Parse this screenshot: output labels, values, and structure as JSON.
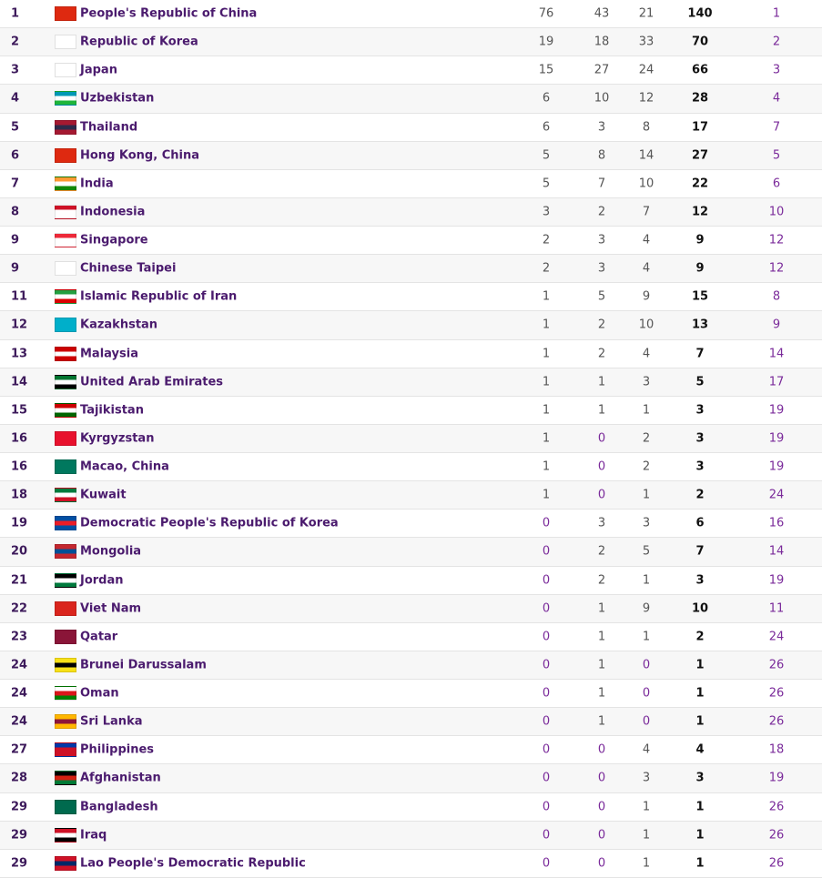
{
  "medal_table": {
    "rows": [
      {
        "rank": "1",
        "country": "People's Republic of China",
        "gold": "76",
        "silver": "43",
        "bronze": "21",
        "total": "140",
        "rank_by_total": "1",
        "flag_icon": "china-flag-icon",
        "flag_colors": [
          "#de2910",
          "#de2910",
          "#de2910"
        ]
      },
      {
        "rank": "2",
        "country": "Republic of Korea",
        "gold": "19",
        "silver": "18",
        "bronze": "33",
        "total": "70",
        "rank_by_total": "2",
        "flag_icon": "south-korea-flag-icon",
        "flag_colors": [
          "#ffffff",
          "#ffffff",
          "#ffffff"
        ]
      },
      {
        "rank": "3",
        "country": "Japan",
        "gold": "15",
        "silver": "27",
        "bronze": "24",
        "total": "66",
        "rank_by_total": "3",
        "flag_icon": "japan-flag-icon",
        "flag_colors": [
          "#ffffff",
          "#ffffff",
          "#ffffff"
        ]
      },
      {
        "rank": "4",
        "country": "Uzbekistan",
        "gold": "6",
        "silver": "10",
        "bronze": "12",
        "total": "28",
        "rank_by_total": "4",
        "flag_icon": "uzbekistan-flag-icon",
        "flag_colors": [
          "#0099b5",
          "#ffffff",
          "#1eb53a"
        ]
      },
      {
        "rank": "5",
        "country": "Thailand",
        "gold": "6",
        "silver": "3",
        "bronze": "8",
        "total": "17",
        "rank_by_total": "7",
        "flag_icon": "thailand-flag-icon",
        "flag_colors": [
          "#a51931",
          "#2d2a4a",
          "#a51931"
        ]
      },
      {
        "rank": "6",
        "country": "Hong Kong, China",
        "gold": "5",
        "silver": "8",
        "bronze": "14",
        "total": "27",
        "rank_by_total": "5",
        "flag_icon": "hong-kong-flag-icon",
        "flag_colors": [
          "#de2910",
          "#de2910",
          "#de2910"
        ]
      },
      {
        "rank": "7",
        "country": "India",
        "gold": "5",
        "silver": "7",
        "bronze": "10",
        "total": "22",
        "rank_by_total": "6",
        "flag_icon": "india-flag-icon",
        "flag_colors": [
          "#ff9933",
          "#ffffff",
          "#138808"
        ]
      },
      {
        "rank": "8",
        "country": "Indonesia",
        "gold": "3",
        "silver": "2",
        "bronze": "7",
        "total": "12",
        "rank_by_total": "10",
        "flag_icon": "indonesia-flag-icon",
        "flag_colors": [
          "#ce1126",
          "#ffffff",
          "#ffffff"
        ]
      },
      {
        "rank": "9",
        "country": "Singapore",
        "gold": "2",
        "silver": "3",
        "bronze": "4",
        "total": "9",
        "rank_by_total": "12",
        "flag_icon": "singapore-flag-icon",
        "flag_colors": [
          "#ed2939",
          "#ffffff",
          "#ffffff"
        ]
      },
      {
        "rank": "9",
        "country": "Chinese Taipei",
        "gold": "2",
        "silver": "3",
        "bronze": "4",
        "total": "9",
        "rank_by_total": "12",
        "flag_icon": "chinese-taipei-flag-icon",
        "flag_colors": [
          "#ffffff",
          "#ffffff",
          "#ffffff"
        ]
      },
      {
        "rank": "11",
        "country": "Islamic Republic of Iran",
        "gold": "1",
        "silver": "5",
        "bronze": "9",
        "total": "15",
        "rank_by_total": "8",
        "flag_icon": "iran-flag-icon",
        "flag_colors": [
          "#239f40",
          "#ffffff",
          "#da0000"
        ]
      },
      {
        "rank": "12",
        "country": "Kazakhstan",
        "gold": "1",
        "silver": "2",
        "bronze": "10",
        "total": "13",
        "rank_by_total": "9",
        "flag_icon": "kazakhstan-flag-icon",
        "flag_colors": [
          "#00afca",
          "#00afca",
          "#00afca"
        ]
      },
      {
        "rank": "13",
        "country": "Malaysia",
        "gold": "1",
        "silver": "2",
        "bronze": "4",
        "total": "7",
        "rank_by_total": "14",
        "flag_icon": "malaysia-flag-icon",
        "flag_colors": [
          "#cc0001",
          "#ffffff",
          "#cc0001"
        ]
      },
      {
        "rank": "14",
        "country": "United Arab Emirates",
        "gold": "1",
        "silver": "1",
        "bronze": "3",
        "total": "5",
        "rank_by_total": "17",
        "flag_icon": "uae-flag-icon",
        "flag_colors": [
          "#00732f",
          "#ffffff",
          "#000000"
        ]
      },
      {
        "rank": "15",
        "country": "Tajikistan",
        "gold": "1",
        "silver": "1",
        "bronze": "1",
        "total": "3",
        "rank_by_total": "19",
        "flag_icon": "tajikistan-flag-icon",
        "flag_colors": [
          "#cc0000",
          "#ffffff",
          "#006600"
        ]
      },
      {
        "rank": "16",
        "country": "Kyrgyzstan",
        "gold": "1",
        "silver": "0",
        "bronze": "2",
        "total": "3",
        "rank_by_total": "19",
        "flag_icon": "kyrgyzstan-flag-icon",
        "flag_colors": [
          "#e8112d",
          "#e8112d",
          "#e8112d"
        ]
      },
      {
        "rank": "16",
        "country": "Macao, China",
        "gold": "1",
        "silver": "0",
        "bronze": "2",
        "total": "3",
        "rank_by_total": "19",
        "flag_icon": "macao-flag-icon",
        "flag_colors": [
          "#00785e",
          "#00785e",
          "#00785e"
        ]
      },
      {
        "rank": "18",
        "country": "Kuwait",
        "gold": "1",
        "silver": "0",
        "bronze": "1",
        "total": "2",
        "rank_by_total": "24",
        "flag_icon": "kuwait-flag-icon",
        "flag_colors": [
          "#007a3d",
          "#ffffff",
          "#ce1126"
        ]
      },
      {
        "rank": "19",
        "country": "Democratic People's Republic of Korea",
        "gold": "0",
        "silver": "3",
        "bronze": "3",
        "total": "6",
        "rank_by_total": "16",
        "flag_icon": "north-korea-flag-icon",
        "flag_colors": [
          "#024fa2",
          "#ed1c27",
          "#024fa2"
        ]
      },
      {
        "rank": "20",
        "country": "Mongolia",
        "gold": "0",
        "silver": "2",
        "bronze": "5",
        "total": "7",
        "rank_by_total": "14",
        "flag_icon": "mongolia-flag-icon",
        "flag_colors": [
          "#c4272f",
          "#015197",
          "#c4272f"
        ]
      },
      {
        "rank": "21",
        "country": "Jordan",
        "gold": "0",
        "silver": "2",
        "bronze": "1",
        "total": "3",
        "rank_by_total": "19",
        "flag_icon": "jordan-flag-icon",
        "flag_colors": [
          "#000000",
          "#ffffff",
          "#007a3d"
        ]
      },
      {
        "rank": "22",
        "country": "Viet Nam",
        "gold": "0",
        "silver": "1",
        "bronze": "9",
        "total": "10",
        "rank_by_total": "11",
        "flag_icon": "vietnam-flag-icon",
        "flag_colors": [
          "#da251d",
          "#da251d",
          "#da251d"
        ]
      },
      {
        "rank": "23",
        "country": "Qatar",
        "gold": "0",
        "silver": "1",
        "bronze": "1",
        "total": "2",
        "rank_by_total": "24",
        "flag_icon": "qatar-flag-icon",
        "flag_colors": [
          "#8a1538",
          "#8a1538",
          "#8a1538"
        ]
      },
      {
        "rank": "24",
        "country": "Brunei Darussalam",
        "gold": "0",
        "silver": "1",
        "bronze": "0",
        "total": "1",
        "rank_by_total": "26",
        "flag_icon": "brunei-flag-icon",
        "flag_colors": [
          "#f7e017",
          "#000000",
          "#f7e017"
        ]
      },
      {
        "rank": "24",
        "country": "Oman",
        "gold": "0",
        "silver": "1",
        "bronze": "0",
        "total": "1",
        "rank_by_total": "26",
        "flag_icon": "oman-flag-icon",
        "flag_colors": [
          "#ffffff",
          "#db161b",
          "#008000"
        ]
      },
      {
        "rank": "24",
        "country": "Sri Lanka",
        "gold": "0",
        "silver": "1",
        "bronze": "0",
        "total": "1",
        "rank_by_total": "26",
        "flag_icon": "sri-lanka-flag-icon",
        "flag_colors": [
          "#ffb700",
          "#8d153a",
          "#ffb700"
        ]
      },
      {
        "rank": "27",
        "country": "Philippines",
        "gold": "0",
        "silver": "0",
        "bronze": "4",
        "total": "4",
        "rank_by_total": "18",
        "flag_icon": "philippines-flag-icon",
        "flag_colors": [
          "#0038a8",
          "#ce1126",
          "#ce1126"
        ]
      },
      {
        "rank": "28",
        "country": "Afghanistan",
        "gold": "0",
        "silver": "0",
        "bronze": "3",
        "total": "3",
        "rank_by_total": "19",
        "flag_icon": "afghanistan-flag-icon",
        "flag_colors": [
          "#000000",
          "#d32011",
          "#007a36"
        ]
      },
      {
        "rank": "29",
        "country": "Bangladesh",
        "gold": "0",
        "silver": "0",
        "bronze": "1",
        "total": "1",
        "rank_by_total": "26",
        "flag_icon": "bangladesh-flag-icon",
        "flag_colors": [
          "#006a4e",
          "#006a4e",
          "#006a4e"
        ]
      },
      {
        "rank": "29",
        "country": "Iraq",
        "gold": "0",
        "silver": "0",
        "bronze": "1",
        "total": "1",
        "rank_by_total": "26",
        "flag_icon": "iraq-flag-icon",
        "flag_colors": [
          "#ce1126",
          "#ffffff",
          "#000000"
        ]
      },
      {
        "rank": "29",
        "country": "Lao People's Democratic Republic",
        "gold": "0",
        "silver": "0",
        "bronze": "1",
        "total": "1",
        "rank_by_total": "26",
        "flag_icon": "laos-flag-icon",
        "flag_colors": [
          "#ce1126",
          "#002868",
          "#ce1126"
        ]
      }
    ]
  }
}
